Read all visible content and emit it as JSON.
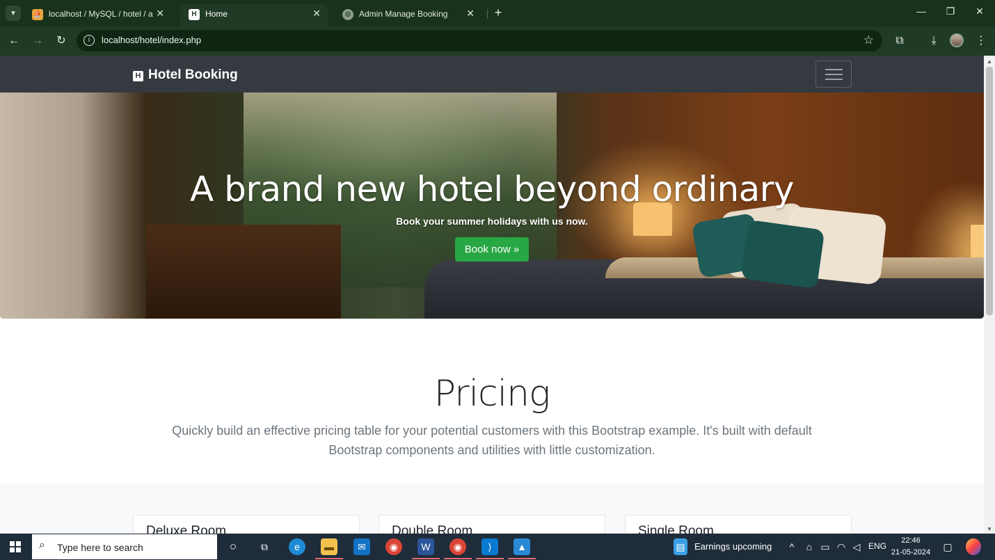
{
  "browser": {
    "tabs": [
      {
        "title": "localhost / MySQL / hotel / adm",
        "active": false
      },
      {
        "title": "Home",
        "active": true
      },
      {
        "title": "Admin Manage Booking",
        "active": false
      }
    ],
    "url": "localhost/hotel/index.php"
  },
  "navbar": {
    "brand_icon": "H",
    "brand": "Hotel Booking"
  },
  "hero": {
    "title": "A brand new hotel beyond ordinary",
    "subtitle": "Book your summer holidays with us now.",
    "button": "Book now »"
  },
  "pricing": {
    "title": "Pricing",
    "lead": "Quickly build an effective pricing table for your potential customers with this Bootstrap example. It's built with default Bootstrap components and utilities with little customization.",
    "cards": [
      {
        "title": "Deluxe Room"
      },
      {
        "title": "Double Room"
      },
      {
        "title": "Single Room"
      }
    ]
  },
  "taskbar": {
    "search_placeholder": "Type here to search",
    "news": "Earnings upcoming",
    "lang": "ENG",
    "time": "22:46",
    "date": "21-05-2024"
  },
  "colors": {
    "chrome_dark": "#18321c",
    "chrome_toolbar": "#203b25",
    "navbar": "#343a40",
    "success": "#28a745"
  }
}
